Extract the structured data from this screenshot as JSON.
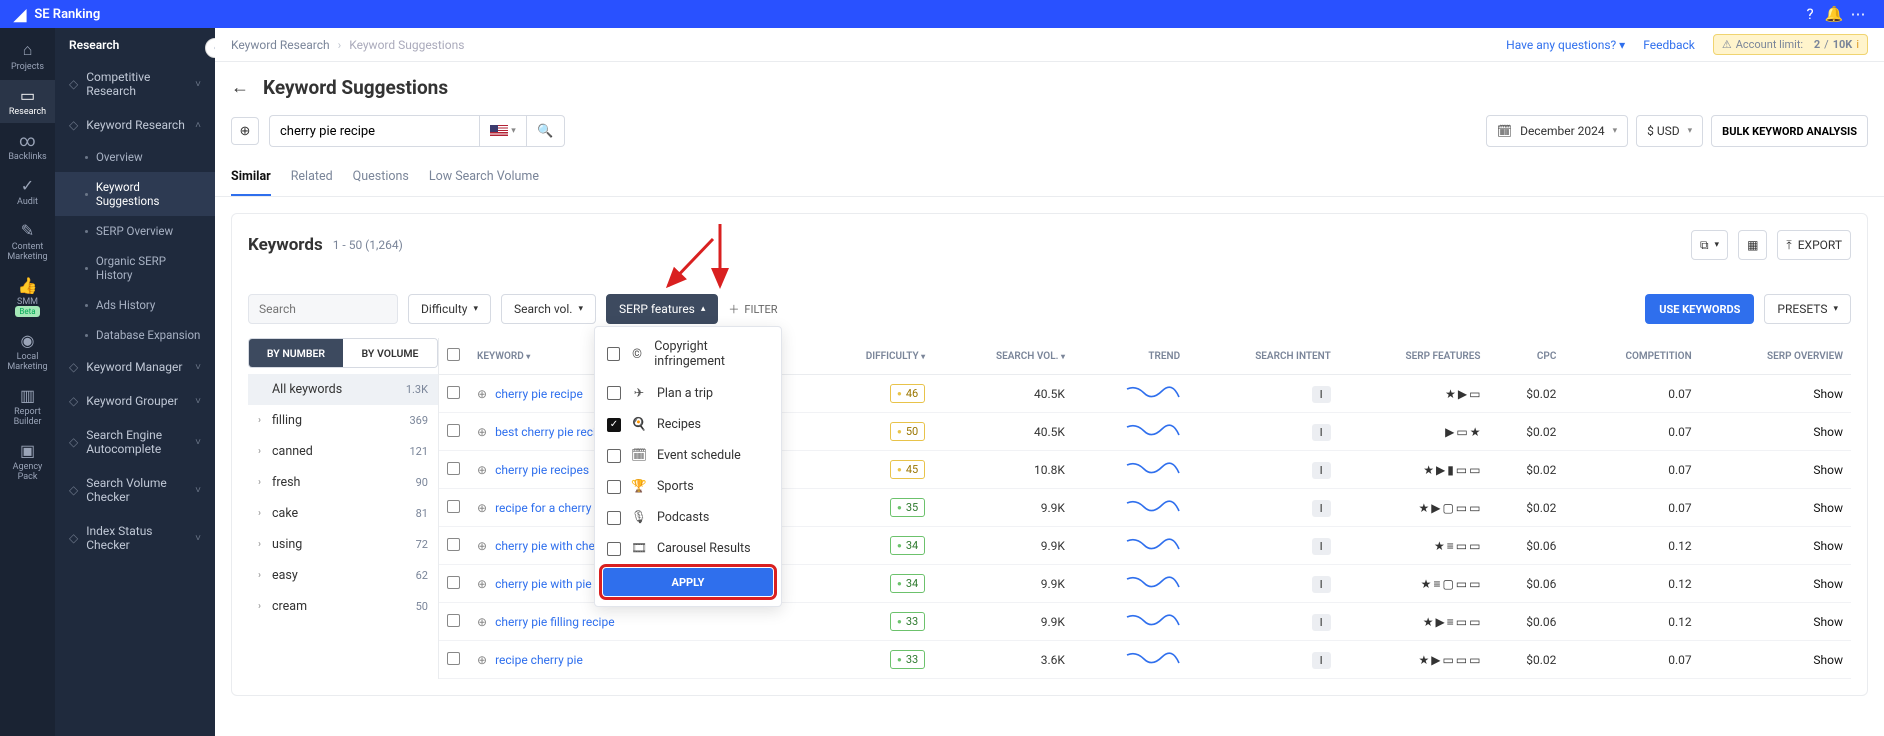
{
  "brand": "SE Ranking",
  "topIcons": [
    "help-icon",
    "bell-icon",
    "more-icon"
  ],
  "rail": [
    {
      "label": "Projects",
      "icon": "⌂"
    },
    {
      "label": "Research",
      "icon": "▭",
      "active": true
    },
    {
      "label": "Backlinks",
      "icon": "∞"
    },
    {
      "label": "Audit",
      "icon": "✓"
    },
    {
      "label": "Content Marketing",
      "icon": "✎"
    },
    {
      "label": "SMM",
      "icon": "👍",
      "beta": "Beta"
    },
    {
      "label": "Local Marketing",
      "icon": "◉"
    },
    {
      "label": "Report Builder",
      "icon": "▥"
    },
    {
      "label": "Agency Pack",
      "icon": "▣"
    }
  ],
  "sidebar": {
    "title": "Research",
    "groups": [
      {
        "label": "Competitive Research",
        "expanded": false
      },
      {
        "label": "Keyword Research",
        "expanded": true,
        "items": [
          {
            "label": "Overview"
          },
          {
            "label": "Keyword Suggestions",
            "active": true
          },
          {
            "label": "SERP Overview"
          },
          {
            "label": "Organic SERP History"
          },
          {
            "label": "Ads History"
          },
          {
            "label": "Database Expansion"
          }
        ]
      },
      {
        "label": "Keyword Manager"
      },
      {
        "label": "Keyword Grouper"
      },
      {
        "label": "Search Engine Autocomplete"
      },
      {
        "label": "Search Volume Checker"
      },
      {
        "label": "Index Status Checker"
      }
    ]
  },
  "breadcrumbs": [
    "Keyword Research",
    "Keyword Suggestions"
  ],
  "header_links": {
    "questions": "Have any questions?",
    "feedback": "Feedback",
    "limit_label": "Account limit:",
    "limit_used": "2",
    "limit_sep": "/",
    "limit_total": "10K"
  },
  "page_title": "Keyword Suggestions",
  "search": {
    "value": "cherry pie recipe",
    "month": "December 2024",
    "currency": "$ USD",
    "bulk": "BULK KEYWORD ANALYSIS"
  },
  "tabs": [
    "Similar",
    "Related",
    "Questions",
    "Low Search Volume"
  ],
  "active_tab": 0,
  "kw_header": {
    "title": "Keywords",
    "range": "1 - 50 (1,264)",
    "export": "EXPORT"
  },
  "filters": {
    "search_placeholder": "Search",
    "difficulty": "Difficulty",
    "volume": "Search vol.",
    "serp": "SERP features",
    "add": "FILTER",
    "use": "USE KEYWORDS",
    "presets": "PRESETS"
  },
  "serp_dropdown": {
    "items": [
      {
        "label": "Copyright infringement",
        "icon": "©",
        "checked": false
      },
      {
        "label": "Plan a trip",
        "icon": "✈",
        "checked": false
      },
      {
        "label": "Recipes",
        "icon": "🍳",
        "checked": true
      },
      {
        "label": "Event schedule",
        "icon": "🗓",
        "checked": false
      },
      {
        "label": "Sports",
        "icon": "🏆",
        "checked": false
      },
      {
        "label": "Podcasts",
        "icon": "🎙",
        "checked": false
      },
      {
        "label": "Carousel Results",
        "icon": "🎞",
        "checked": false
      }
    ],
    "apply": "APPLY"
  },
  "toggle": {
    "by_number": "BY NUMBER",
    "by_volume": "BY VOLUME"
  },
  "left_filters": [
    {
      "label": "All keywords",
      "count": "1.3K",
      "active": true,
      "exp": false
    },
    {
      "label": "filling",
      "count": "369",
      "exp": true
    },
    {
      "label": "canned",
      "count": "121",
      "exp": true
    },
    {
      "label": "fresh",
      "count": "90",
      "exp": true
    },
    {
      "label": "cake",
      "count": "81",
      "exp": true
    },
    {
      "label": "using",
      "count": "72",
      "exp": true
    },
    {
      "label": "easy",
      "count": "62",
      "exp": true
    },
    {
      "label": "cream",
      "count": "50",
      "exp": true
    }
  ],
  "columns": [
    "KEYWORD",
    "DIFFICULTY",
    "SEARCH VOL.",
    "TREND",
    "SEARCH INTENT",
    "SERP FEATURES",
    "CPC",
    "COMPETITION",
    "SERP OVERVIEW"
  ],
  "rows": [
    {
      "kw": "cherry pie recipe",
      "diff": "46",
      "diffCls": "y",
      "vol": "40.5K",
      "intent": "I",
      "serp": [
        "★",
        "▶",
        "▭"
      ],
      "cpc": "$0.02",
      "comp": "0.07",
      "show": "Show"
    },
    {
      "kw": "best cherry pie recipe",
      "diff": "50",
      "diffCls": "y",
      "vol": "40.5K",
      "intent": "I",
      "serp": [
        "▶",
        "▭",
        "★"
      ],
      "cpc": "$0.02",
      "comp": "0.07",
      "show": "Show"
    },
    {
      "kw": "cherry pie recipes",
      "diff": "45",
      "diffCls": "y",
      "vol": "10.8K",
      "intent": "I",
      "serp": [
        "★",
        "▶",
        "▮",
        "▭",
        "▭"
      ],
      "cpc": "$0.02",
      "comp": "0.07",
      "show": "Show"
    },
    {
      "kw": "recipe for a cherry pie",
      "diff": "35",
      "diffCls": "g",
      "vol": "9.9K",
      "intent": "I",
      "serp": [
        "★",
        "▶",
        "▢",
        "▭",
        "▭"
      ],
      "cpc": "$0.02",
      "comp": "0.07",
      "show": "Show"
    },
    {
      "kw": "cherry pie with cherry",
      "diff": "34",
      "diffCls": "g",
      "vol": "9.9K",
      "intent": "I",
      "serp": [
        "★",
        "≡",
        "▭",
        "▭"
      ],
      "cpc": "$0.06",
      "comp": "0.12",
      "show": "Show"
    },
    {
      "kw": "cherry pie with pie fill",
      "diff": "34",
      "diffCls": "g",
      "vol": "9.9K",
      "intent": "I",
      "serp": [
        "★",
        "≡",
        "▢",
        "▭",
        "▭"
      ],
      "cpc": "$0.06",
      "comp": "0.12",
      "show": "Show"
    },
    {
      "kw": "cherry pie filling recipe",
      "diff": "33",
      "diffCls": "g",
      "vol": "9.9K",
      "intent": "I",
      "serp": [
        "★",
        "▶",
        "≡",
        "▭",
        "▭"
      ],
      "cpc": "$0.06",
      "comp": "0.12",
      "show": "Show"
    },
    {
      "kw": "recipe cherry pie",
      "diff": "33",
      "diffCls": "g",
      "vol": "3.6K",
      "intent": "I",
      "serp": [
        "★",
        "▶",
        "▭",
        "▭",
        "▭"
      ],
      "cpc": "$0.02",
      "comp": "0.07",
      "show": "Show"
    }
  ]
}
